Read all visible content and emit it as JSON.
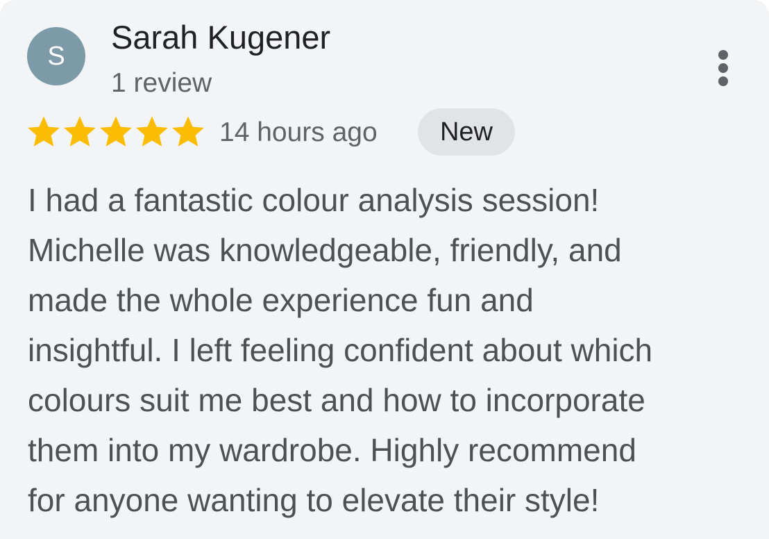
{
  "reviewer": {
    "name": "Sarah Kugener",
    "avatar_initial": "S",
    "avatar_color": "#7c9aa8",
    "review_count": "1 review"
  },
  "more_menu_icon": "more-vert-icon",
  "rating": {
    "stars": 5,
    "max": 5,
    "star_color": "#fbbc04"
  },
  "time_ago": "14 hours ago",
  "badge": "New",
  "review_lines": [
    "I had a fantastic colour analysis session!",
    "Michelle was knowledgeable, friendly, and",
    "made the whole experience fun and",
    "insightful. I left feeling confident about which",
    "colours suit me best and how to incorporate",
    "them into my wardrobe. Highly recommend",
    "for anyone wanting to elevate their style!"
  ]
}
